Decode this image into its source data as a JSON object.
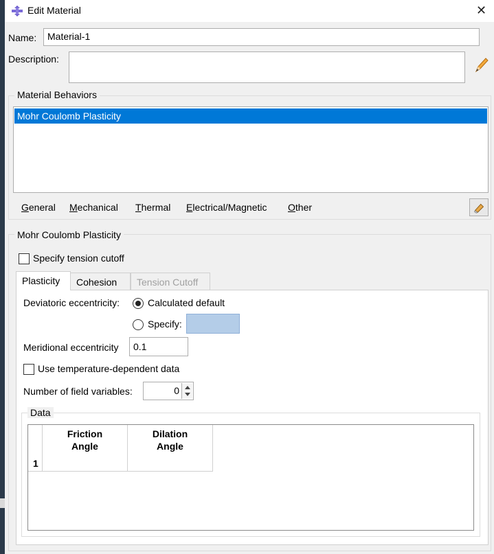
{
  "window": {
    "title": "Edit Material",
    "close_glyph": "✕"
  },
  "name": {
    "label": "Name:",
    "value": "Material-1"
  },
  "description": {
    "label": "Description:",
    "value": ""
  },
  "behaviors": {
    "group_title": "Material Behaviors",
    "items": [
      "Mohr Coulomb Plasticity"
    ],
    "menu": [
      "General",
      "Mechanical",
      "Thermal",
      "Electrical/Magnetic",
      "Other"
    ]
  },
  "section": {
    "group_title": "Mohr Coulomb Plasticity",
    "tension_cutoff_label": "Specify tension cutoff",
    "tension_cutoff_checked": false,
    "tabs": [
      {
        "label": "Plasticity",
        "state": "active"
      },
      {
        "label": "Cohesion",
        "state": "normal"
      },
      {
        "label": "Tension Cutoff",
        "state": "disabled"
      }
    ]
  },
  "plasticity": {
    "deviatoric_label": "Deviatoric eccentricity:",
    "calc_default_label": "Calculated default",
    "specify_label": "Specify:",
    "meridional_label": "Meridional eccentricity",
    "meridional_value": "0.1",
    "temp_dep_label": "Use temperature-dependent data",
    "temp_dep_checked": false,
    "field_vars_label": "Number of field variables:",
    "field_vars_value": "0",
    "data_group_title": "Data",
    "table": {
      "columns": [
        {
          "line1": "Friction",
          "line2": "Angle"
        },
        {
          "line1": "Dilation",
          "line2": "Angle"
        }
      ],
      "rows": [
        {
          "index": "1",
          "cells": [
            "",
            ""
          ]
        }
      ]
    }
  },
  "icons": {
    "app": "abaqus-material-icon",
    "close": "close-icon",
    "pencil": "pencil-icon",
    "eraser": "eraser-icon"
  },
  "colors": {
    "selection": "#0078d7",
    "disabled_field": "#b4cde8",
    "dialog_bg": "#f0f0f0"
  }
}
